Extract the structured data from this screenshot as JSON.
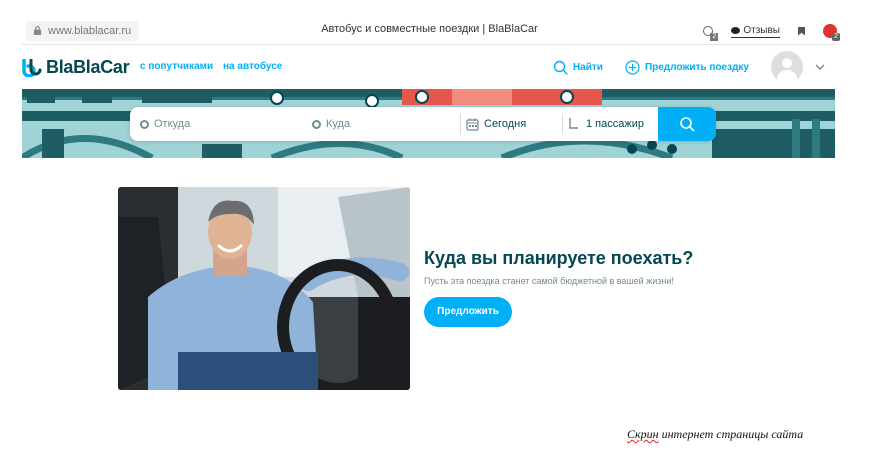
{
  "browser": {
    "url": "www.blablacar.ru",
    "tab_title": "Автобус и совместные поездки | BlaBlaCar",
    "reviews_label": "Отзывы",
    "extension_badge_1": "2",
    "extension_badge_2": "2"
  },
  "header": {
    "logo_text": "BlaBlaCar",
    "nav_carpool": "с попутчиками",
    "nav_bus": "на автобусе",
    "find_label": "Найти",
    "offer_label": "Предложить поездку"
  },
  "search": {
    "from_placeholder": "Откуда",
    "to_placeholder": "Куда",
    "date_value": "Сегодня",
    "passengers_value": "1 пассажир"
  },
  "promo": {
    "title": "Куда вы планируете поехать?",
    "subtitle": "Пусть эта поездка станет самой бюджетной в вашей жизни!",
    "button_label": "Предложить"
  },
  "caption": {
    "word1": "Скрин",
    "rest": " интернет страницы сайта"
  },
  "colors": {
    "brand_blue": "#00aff5",
    "brand_dark": "#054752",
    "banner_teal": "#9fd3d6"
  }
}
